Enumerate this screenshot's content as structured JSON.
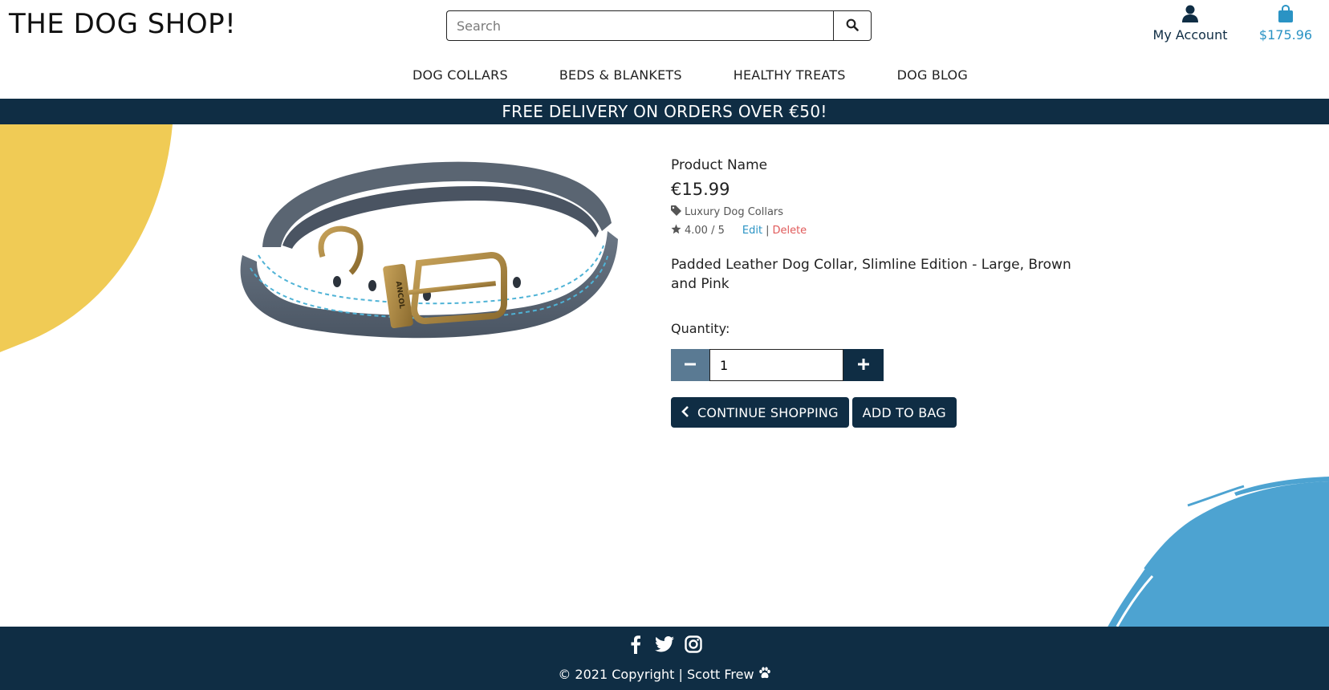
{
  "header": {
    "brand": "THE DOG SHOP!",
    "search_placeholder": "Search",
    "account_label": "My Account",
    "bag_total": "$175.96"
  },
  "nav": {
    "items": [
      {
        "label": "DOG COLLARS"
      },
      {
        "label": "BEDS & BLANKETS"
      },
      {
        "label": "HEALTHY TREATS"
      },
      {
        "label": "DOG BLOG"
      }
    ]
  },
  "banner": {
    "text": "FREE DELIVERY ON ORDERS OVER €50!"
  },
  "product": {
    "name": "Product Name",
    "price": "€15.99",
    "category": "Luxury Dog Collars",
    "rating": "4.00 / 5",
    "edit_label": "Edit",
    "separator": "|",
    "delete_label": "Delete",
    "description": "Padded Leather Dog Collar, Slimline Edition - Large, Brown and Pink",
    "image_brand_text": "ANCOL"
  },
  "quantity": {
    "label": "Quantity:",
    "value": "1"
  },
  "actions": {
    "continue_label": "CONTINUE SHOPPING",
    "add_label": "ADD TO BAG"
  },
  "footer": {
    "copyright": "© 2021 Copyright | Scott Frew"
  },
  "colors": {
    "navy": "#0f2d44",
    "accent_blue": "#2a93c4",
    "yellow": "#f0cb55",
    "delete_red": "#e05a5a",
    "minus_button": "#5a7a93"
  },
  "icons": [
    "search-icon",
    "user-icon",
    "shopping-bag-icon",
    "tag-icon",
    "star-icon",
    "minus-icon",
    "plus-icon",
    "chevron-left-icon",
    "facebook-icon",
    "twitter-icon",
    "instagram-icon",
    "paw-icon"
  ]
}
